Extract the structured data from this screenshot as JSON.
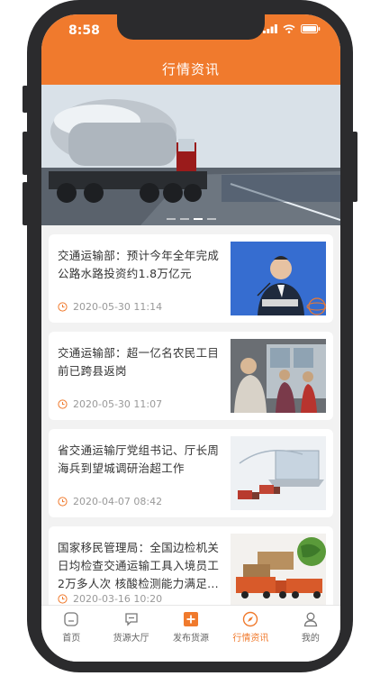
{
  "status_bar": {
    "time": "8:58"
  },
  "header": {
    "title": "行情资讯"
  },
  "banner": {
    "slide_count": 4,
    "active_index": 2
  },
  "news": [
    {
      "title": "交通运输部：预计今年全年完成公路水路投资约1.8万亿元",
      "time": "2020-05-30 11:14",
      "image": "press-conference-speaker"
    },
    {
      "title": "交通运输部：超一亿名农民工目前已跨县返岗",
      "time": "2020-05-30 11:07",
      "image": "workers-boarding-bus"
    },
    {
      "title": "省交通运输厅党组书记、厅长周海兵到望城调研治超工作",
      "time": "2020-04-07 08:42",
      "image": "laptop-with-trucks"
    },
    {
      "title": "国家移民管理局：全国边检机关日均检查交通运输工具入境员工2万多人次 核酸检测能力满足...",
      "time": "2020-03-16 10:20",
      "image": "trucks-and-globe"
    }
  ],
  "tabbar": [
    {
      "label": "首页",
      "icon": "home-icon",
      "active": false
    },
    {
      "label": "货源大厅",
      "icon": "chat-icon",
      "active": false
    },
    {
      "label": "发布货源",
      "icon": "plus-box-icon",
      "active": false
    },
    {
      "label": "行情资讯",
      "icon": "compass-icon",
      "active": true
    },
    {
      "label": "我的",
      "icon": "user-icon",
      "active": false
    }
  ],
  "colors": {
    "accent": "#f07a2d",
    "frame": "#2b2b2d",
    "background": "#f2f2f2"
  }
}
